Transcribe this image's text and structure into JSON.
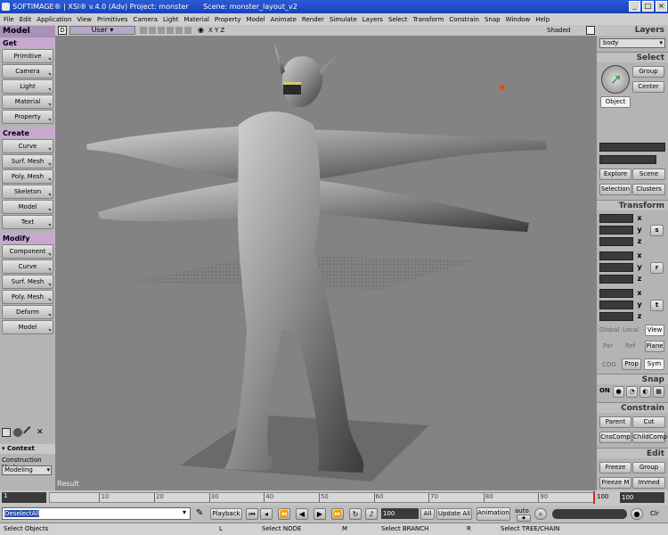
{
  "window": {
    "title": "SOFTIMAGE® | XSI® v.4.0 (Adv) Project: monster",
    "scene": "Scene: monster_layout_v2"
  },
  "menu": [
    "File",
    "Edit",
    "Application",
    "View",
    "Primitives",
    "Camera",
    "Light",
    "Material",
    "Property",
    "Model",
    "Animate",
    "Render",
    "Simulate",
    "Layers",
    "Select",
    "Transform",
    "Constrain",
    "Snap",
    "Window",
    "Help"
  ],
  "left": {
    "module": "Model",
    "get": {
      "header": "Get",
      "items": [
        "Primitive",
        "Camera",
        "Light",
        "Material",
        "Property"
      ]
    },
    "create": {
      "header": "Create",
      "items": [
        "Curve",
        "Surf. Mesh",
        "Poly. Mesh",
        "Skeleton",
        "Model",
        "Text"
      ]
    },
    "modify": {
      "header": "Modify",
      "items": [
        "Component",
        "Curve",
        "Surf. Mesh",
        "Poly. Mesh",
        "Deform",
        "Model"
      ]
    },
    "context": {
      "header": "Context",
      "label": "Construction Mode",
      "mode": "Modeling"
    }
  },
  "viewport": {
    "letter": "D",
    "camera": "User",
    "axes": "X Y Z",
    "display": "Shaded",
    "result": "Result"
  },
  "right": {
    "layers": {
      "header": "Layers",
      "value": "body"
    },
    "select": {
      "header": "Select",
      "group": "Group",
      "center": "Center",
      "object": "Object",
      "explore": "Explore",
      "scene": "Scene",
      "selection": "Selection",
      "clusters": "Clusters"
    },
    "transform": {
      "header": "Transform",
      "s": "s",
      "r": "r",
      "t": "t",
      "x": "x",
      "y": "y",
      "z": "z",
      "global": "Global",
      "local": "Local",
      "view": "View",
      "par": "Par",
      "ref": "Ref",
      "plane": "Plane",
      "cog": "COG",
      "prop": "Prop",
      "sym": "Sym"
    },
    "snap": {
      "header": "Snap",
      "on": "ON"
    },
    "constrain": {
      "header": "Constrain",
      "parent": "Parent",
      "cut": "Cut",
      "cnscomp": "CnsComp",
      "childcomp": "ChildComp"
    },
    "edit": {
      "header": "Edit",
      "freeze": "Freeze",
      "group": "Group",
      "freezem": "Freeze M",
      "immed": "Immed"
    }
  },
  "timeline": {
    "start": "1",
    "ticks": [
      "10",
      "20",
      "30",
      "40",
      "50",
      "60",
      "70",
      "80",
      "90"
    ],
    "end": "100",
    "endbox": "100"
  },
  "playbar": {
    "command": "DeselectAll",
    "playback": "Playback",
    "frame": "100",
    "all": "All",
    "update": "Update All",
    "animation": "Animation",
    "auto": "auto",
    "clr": "Clr"
  },
  "status": {
    "left": "Select Objects",
    "l": "L",
    "node": "Select NODE",
    "m": "M",
    "branch": "Select BRANCH",
    "r": "R",
    "tree": "Select TREE/CHAIN"
  },
  "colors": {
    "title": "#1842b8",
    "header_purple": "#c8a8d0",
    "viewport": "#838383"
  }
}
